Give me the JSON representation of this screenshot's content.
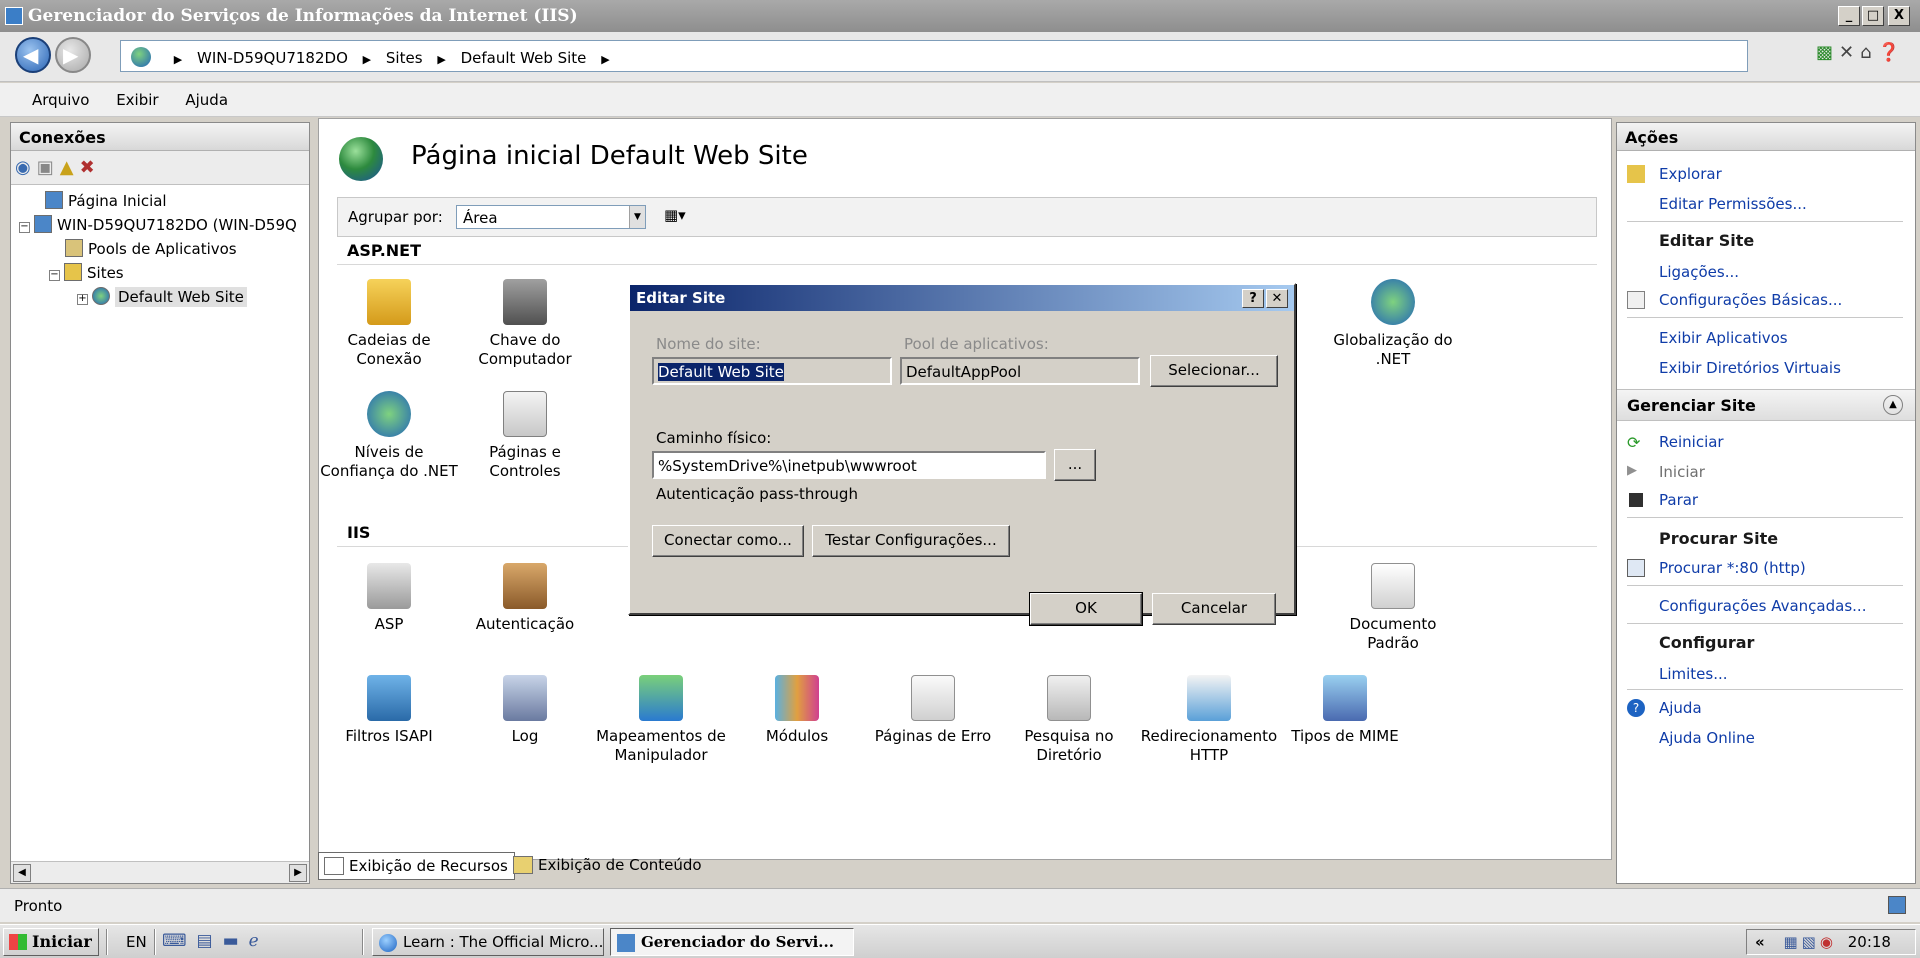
{
  "window": {
    "title": "Gerenciador do Serviços de Informações da Internet (IIS)",
    "controls": [
      "_",
      "□",
      "X"
    ]
  },
  "address": {
    "crumbs": [
      "WIN-D59QU7182DO",
      "Sites",
      "Default Web Site"
    ]
  },
  "menu": [
    "Arquivo",
    "Exibir",
    "Ajuda"
  ],
  "connections": {
    "header": "Conexões",
    "tree": [
      {
        "label": "Página Inicial"
      },
      {
        "label": "WIN-D59QU7182DO (WIN-D59Q"
      },
      {
        "label": "Pools de Aplicativos"
      },
      {
        "label": "Sites"
      },
      {
        "label": "Default Web Site"
      }
    ]
  },
  "center": {
    "title": "Página inicial Default Web Site",
    "group_label": "Agrupar por:",
    "group_value": "Área",
    "sections": {
      "aspnet": "ASP.NET",
      "iis": "IIS"
    },
    "aspnet_features": [
      "Cadeias de\nConexão",
      "Chave do\nComputador",
      "Globalização do\n.NET",
      "Níveis de\nConfiança do .NET",
      "Páginas e\nControles"
    ],
    "iis_features_row1": [
      "ASP",
      "Autenticação",
      "Documento\nPadrão"
    ],
    "iis_features_row2": [
      "Filtros ISAPI",
      "Log",
      "Mapeamentos de\nManipulador",
      "Módulos",
      "Páginas de Erro",
      "Pesquisa no\nDiretório",
      "Redirecionamento\nHTTP",
      "Tipos de MIME"
    ],
    "bottom_tabs": [
      "Exibição de Recursos",
      "Exibição de Conteúdo"
    ]
  },
  "actions": {
    "header": "Ações",
    "explore": "Explorar",
    "edit_permissions": "Editar Permissões...",
    "edit_site_group": "Editar Site",
    "bindings": "Ligações...",
    "basic_settings": "Configurações Básicas...",
    "view_apps": "Exibir Aplicativos",
    "view_vdirs": "Exibir Diretórios Virtuais",
    "manage_site_group": "Gerenciar Site",
    "restart": "Reiniciar",
    "start": "Iniciar",
    "stop": "Parar",
    "browse_group": "Procurar Site",
    "browse_80": "Procurar *:80 (http)",
    "advanced_settings": "Configurações Avançadas...",
    "configure_group": "Configurar",
    "limits": "Limites...",
    "help": "Ajuda",
    "help_online": "Ajuda Online"
  },
  "status": "Pronto",
  "taskbar": {
    "start": "Iniciar",
    "lang": "EN",
    "tasks": [
      "Learn : The Official Micro...",
      "Gerenciador do Servi..."
    ],
    "clock": "20:18"
  },
  "dialog": {
    "title": "Editar Site",
    "site_name_label": "Nome do site:",
    "site_name": "Default Web Site",
    "pool_label": "Pool de aplicativos:",
    "pool": "DefaultAppPool",
    "select_button": "Selecionar...",
    "path_label": "Caminho físico:",
    "path": "%SystemDrive%\\inetpub\\wwwroot",
    "browse_button": "...",
    "passthrough": "Autenticação pass-through",
    "connect_as": "Conectar como...",
    "test_settings": "Testar Configurações...",
    "ok": "OK",
    "cancel": "Cancelar"
  },
  "colors": {
    "link": "#0f3ca8",
    "dialog_title": "#0a246a",
    "selection": "#0a246a"
  }
}
